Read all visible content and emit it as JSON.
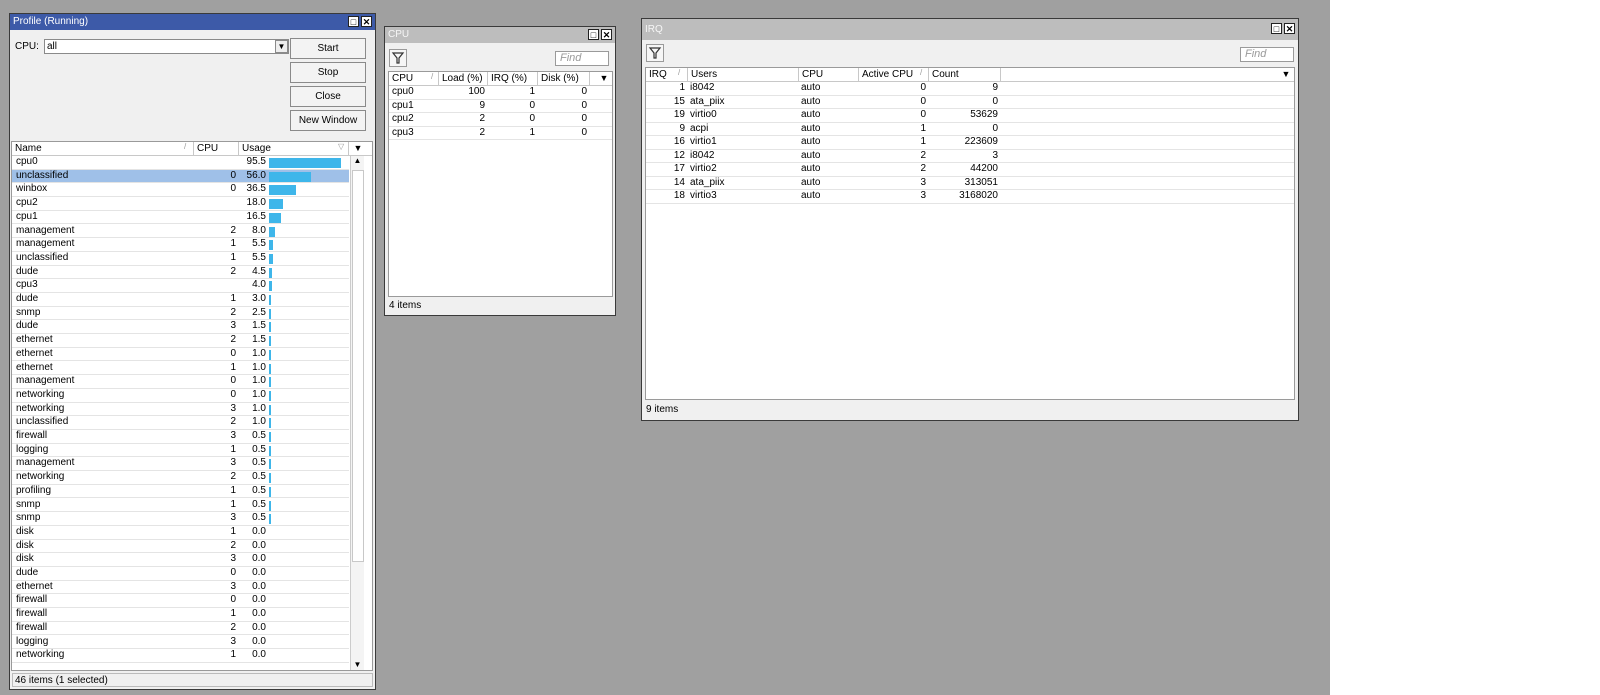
{
  "profile_window": {
    "title": "Profile (Running)",
    "cpu_label": "CPU:",
    "cpu_value": "all",
    "buttons": {
      "start": "Start",
      "stop": "Stop",
      "close": "Close",
      "new_window": "New Window"
    },
    "columns": [
      "Name",
      "CPU",
      "Usage"
    ],
    "rows": [
      {
        "name": "cpu0",
        "cpu": "",
        "usage": "95.5"
      },
      {
        "name": "unclassified",
        "cpu": "0",
        "usage": "56.0",
        "selected": true
      },
      {
        "name": "winbox",
        "cpu": "0",
        "usage": "36.5"
      },
      {
        "name": "cpu2",
        "cpu": "",
        "usage": "18.0"
      },
      {
        "name": "cpu1",
        "cpu": "",
        "usage": "16.5"
      },
      {
        "name": "management",
        "cpu": "2",
        "usage": "8.0"
      },
      {
        "name": "management",
        "cpu": "1",
        "usage": "5.5"
      },
      {
        "name": "unclassified",
        "cpu": "1",
        "usage": "5.5"
      },
      {
        "name": "dude",
        "cpu": "2",
        "usage": "4.5"
      },
      {
        "name": "cpu3",
        "cpu": "",
        "usage": "4.0"
      },
      {
        "name": "dude",
        "cpu": "1",
        "usage": "3.0"
      },
      {
        "name": "snmp",
        "cpu": "2",
        "usage": "2.5"
      },
      {
        "name": "dude",
        "cpu": "3",
        "usage": "1.5"
      },
      {
        "name": "ethernet",
        "cpu": "2",
        "usage": "1.5"
      },
      {
        "name": "ethernet",
        "cpu": "0",
        "usage": "1.0"
      },
      {
        "name": "ethernet",
        "cpu": "1",
        "usage": "1.0"
      },
      {
        "name": "management",
        "cpu": "0",
        "usage": "1.0"
      },
      {
        "name": "networking",
        "cpu": "0",
        "usage": "1.0"
      },
      {
        "name": "networking",
        "cpu": "3",
        "usage": "1.0"
      },
      {
        "name": "unclassified",
        "cpu": "2",
        "usage": "1.0"
      },
      {
        "name": "firewall",
        "cpu": "3",
        "usage": "0.5"
      },
      {
        "name": "logging",
        "cpu": "1",
        "usage": "0.5"
      },
      {
        "name": "management",
        "cpu": "3",
        "usage": "0.5"
      },
      {
        "name": "networking",
        "cpu": "2",
        "usage": "0.5"
      },
      {
        "name": "profiling",
        "cpu": "1",
        "usage": "0.5"
      },
      {
        "name": "snmp",
        "cpu": "1",
        "usage": "0.5"
      },
      {
        "name": "snmp",
        "cpu": "3",
        "usage": "0.5"
      },
      {
        "name": "disk",
        "cpu": "1",
        "usage": "0.0"
      },
      {
        "name": "disk",
        "cpu": "2",
        "usage": "0.0"
      },
      {
        "name": "disk",
        "cpu": "3",
        "usage": "0.0"
      },
      {
        "name": "dude",
        "cpu": "0",
        "usage": "0.0"
      },
      {
        "name": "ethernet",
        "cpu": "3",
        "usage": "0.0"
      },
      {
        "name": "firewall",
        "cpu": "0",
        "usage": "0.0"
      },
      {
        "name": "firewall",
        "cpu": "1",
        "usage": "0.0"
      },
      {
        "name": "firewall",
        "cpu": "2",
        "usage": "0.0"
      },
      {
        "name": "logging",
        "cpu": "3",
        "usage": "0.0"
      },
      {
        "name": "networking",
        "cpu": "1",
        "usage": "0.0"
      }
    ],
    "status": "46 items (1 selected)"
  },
  "cpu_window": {
    "title": "CPU",
    "find_placeholder": "Find",
    "columns": [
      "CPU",
      "Load (%)",
      "IRQ (%)",
      "Disk (%)"
    ],
    "rows": [
      {
        "cpu": "cpu0",
        "load": "100",
        "irq": "1",
        "disk": "0"
      },
      {
        "cpu": "cpu1",
        "load": "9",
        "irq": "0",
        "disk": "0"
      },
      {
        "cpu": "cpu2",
        "load": "2",
        "irq": "0",
        "disk": "0"
      },
      {
        "cpu": "cpu3",
        "load": "2",
        "irq": "1",
        "disk": "0"
      }
    ],
    "status": "4 items"
  },
  "irq_window": {
    "title": "IRQ",
    "find_placeholder": "Find",
    "columns": [
      "IRQ",
      "Users",
      "CPU",
      "Active CPU",
      "Count"
    ],
    "rows": [
      {
        "irq": "1",
        "users": "i8042",
        "cpu": "auto",
        "active_cpu": "0",
        "count": "9"
      },
      {
        "irq": "15",
        "users": "ata_piix",
        "cpu": "auto",
        "active_cpu": "0",
        "count": "0"
      },
      {
        "irq": "19",
        "users": "virtio0",
        "cpu": "auto",
        "active_cpu": "0",
        "count": "53629"
      },
      {
        "irq": "9",
        "users": "acpi",
        "cpu": "auto",
        "active_cpu": "1",
        "count": "0"
      },
      {
        "irq": "16",
        "users": "virtio1",
        "cpu": "auto",
        "active_cpu": "1",
        "count": "223609"
      },
      {
        "irq": "12",
        "users": "i8042",
        "cpu": "auto",
        "active_cpu": "2",
        "count": "3"
      },
      {
        "irq": "17",
        "users": "virtio2",
        "cpu": "auto",
        "active_cpu": "2",
        "count": "44200"
      },
      {
        "irq": "14",
        "users": "ata_piix",
        "cpu": "auto",
        "active_cpu": "3",
        "count": "313051"
      },
      {
        "irq": "18",
        "users": "virtio3",
        "cpu": "auto",
        "active_cpu": "3",
        "count": "3168020"
      }
    ],
    "status": "9 items"
  },
  "colors": {
    "usage_bar": "#3eb6ea",
    "selected_row": "#9fc0e8",
    "active_title": "#3d5aa8"
  }
}
